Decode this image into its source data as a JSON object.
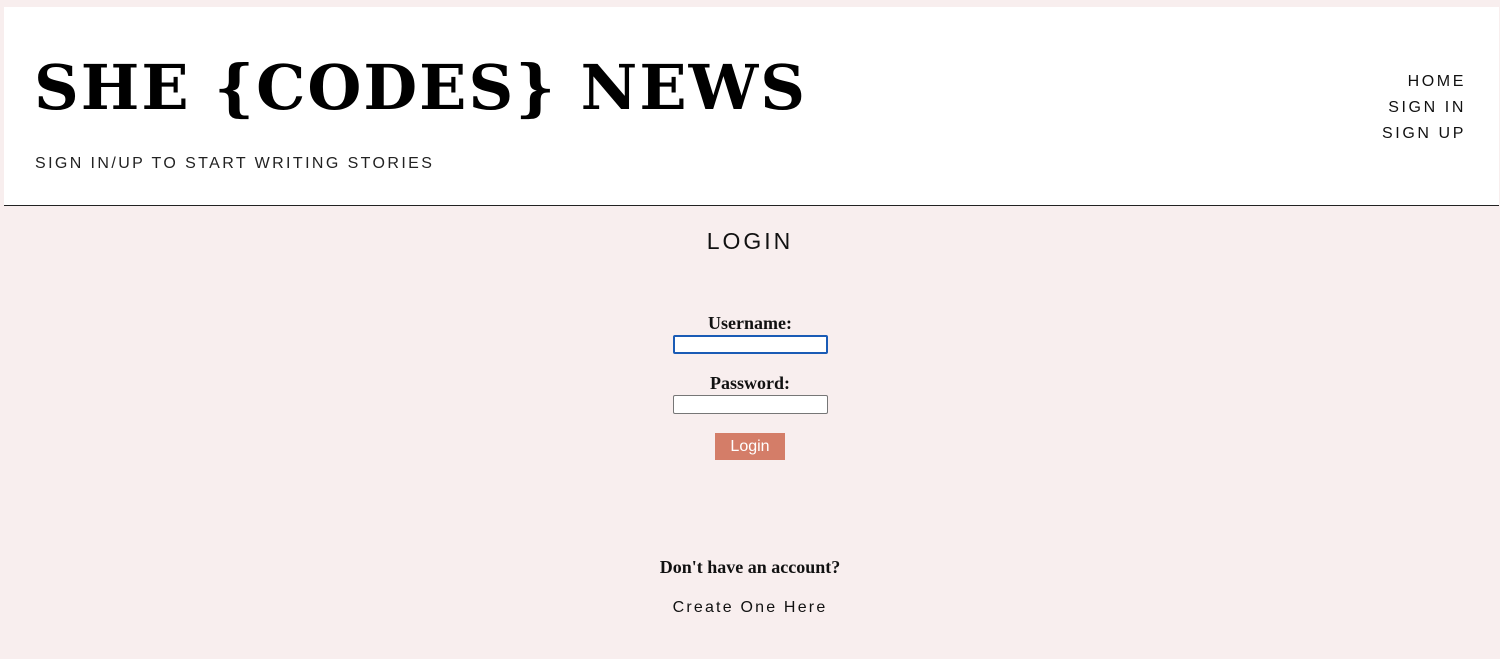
{
  "header": {
    "title": "SHE {CODES} NEWS",
    "tagline": "SIGN IN/UP TO START WRITING STORIES",
    "nav": [
      {
        "label": "HOME"
      },
      {
        "label": "SIGN IN"
      },
      {
        "label": "SIGN UP"
      }
    ]
  },
  "login": {
    "heading": "LOGIN",
    "username_label": "Username:",
    "username_value": "",
    "password_label": "Password:",
    "password_value": "",
    "submit_label": "Login"
  },
  "signup_prompt": {
    "text": "Don't have an account?",
    "link_label": "Create One Here"
  },
  "colors": {
    "page_background": "#f8eeee",
    "header_background": "#ffffff",
    "button_background": "#d47d68",
    "focus_border": "#1a5bb5"
  }
}
